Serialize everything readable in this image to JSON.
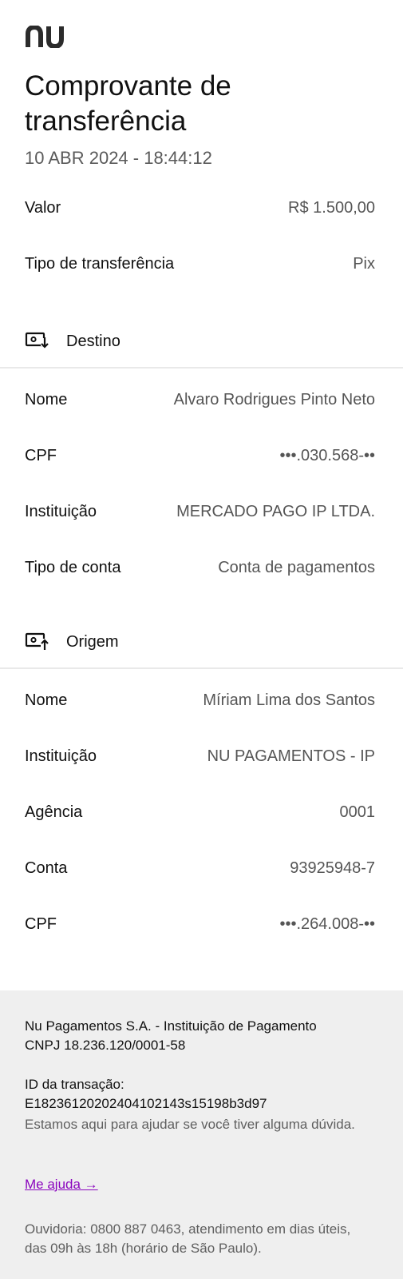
{
  "brand": {
    "logo": "nu",
    "accent": "#8a05be"
  },
  "header": {
    "title": "Comprovante de transferência",
    "datetime": "10 ABR 2024 - 18:44:12"
  },
  "summary": [
    {
      "label": "Valor",
      "value": "R$ 1.500,00"
    },
    {
      "label": "Tipo de transferência",
      "value": "Pix"
    }
  ],
  "destino": {
    "title": "Destino",
    "icon": "download-to-screen-icon",
    "rows": [
      {
        "label": "Nome",
        "value": "Alvaro Rodrigues Pinto Neto"
      },
      {
        "label": "CPF",
        "value": "•••.030.568-••"
      },
      {
        "label": "Instituição",
        "value": "MERCADO PAGO IP LTDA."
      },
      {
        "label": "Tipo de conta",
        "value": "Conta de pagamentos"
      }
    ]
  },
  "origem": {
    "title": "Origem",
    "icon": "upload-from-screen-icon",
    "rows": [
      {
        "label": "Nome",
        "value": "Míriam Lima dos Santos"
      },
      {
        "label": "Instituição",
        "value": "NU PAGAMENTOS - IP"
      },
      {
        "label": "Agência",
        "value": "0001"
      },
      {
        "label": "Conta",
        "value": "93925948-7"
      },
      {
        "label": "CPF",
        "value": "•••.264.008-••"
      }
    ]
  },
  "footer": {
    "company": "Nu Pagamentos S.A. - Instituição de Pagamento",
    "cnpj": "CNPJ 18.236.120/0001-58",
    "transaction_id_label": "ID da transação:",
    "transaction_id": "E18236120202404102143s15198b3d97",
    "help_text": "Estamos aqui para ajudar se você tiver alguma dúvida.",
    "help_link": "Me ajuda →",
    "ouvidoria": "Ouvidoria: 0800 887 0463, atendimento em dias úteis, das 09h às 18h (horário de São Paulo)."
  }
}
